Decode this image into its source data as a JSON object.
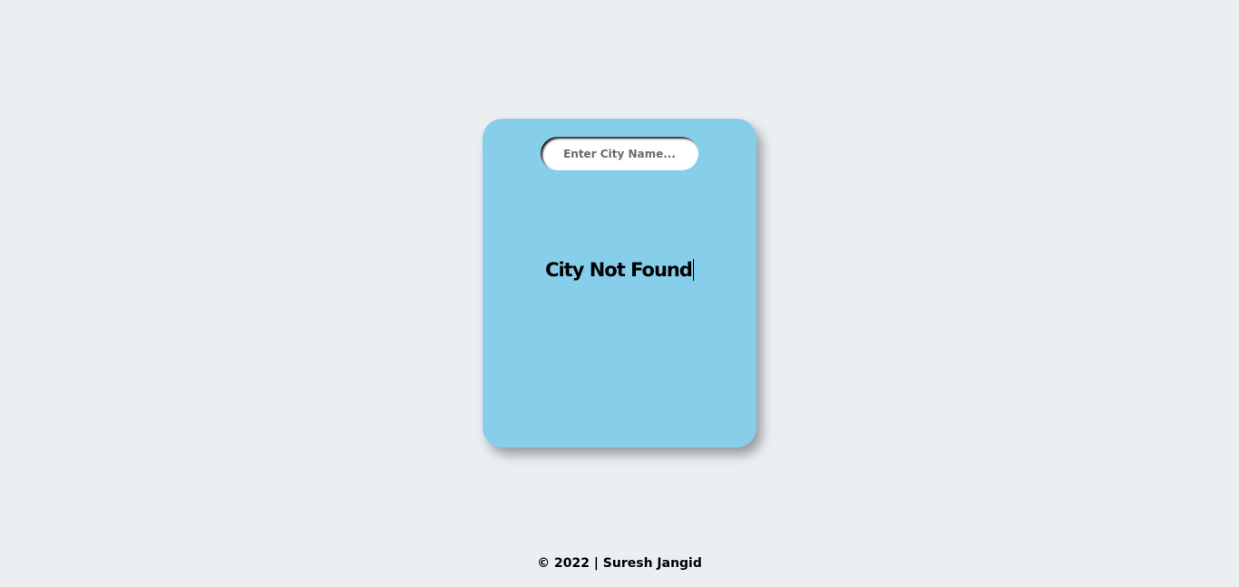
{
  "search": {
    "placeholder": "Enter City Name...",
    "value": ""
  },
  "weather": {
    "status_message": "City Not Found"
  },
  "footer": {
    "text": "© 2022 | Suresh Jangid"
  },
  "colors": {
    "page_background": "#ebeff2",
    "card_background": "#87ceeb",
    "input_background": "#ffffff",
    "text": "#000000"
  }
}
